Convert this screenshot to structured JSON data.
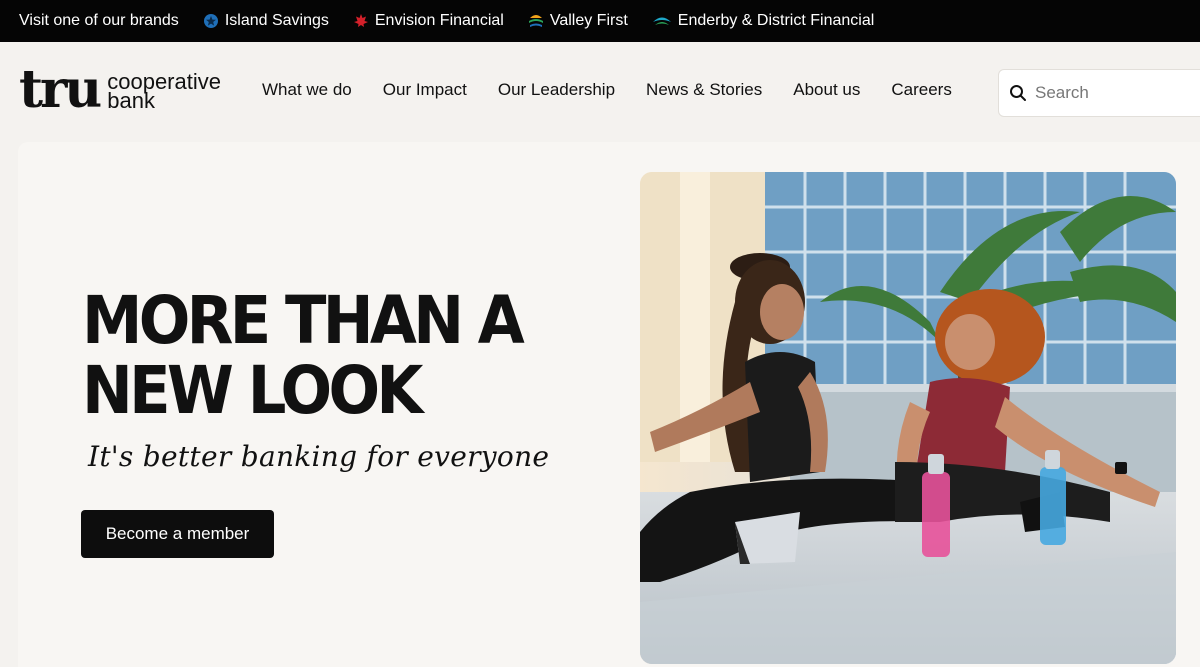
{
  "brandbar": {
    "visit_label": "Visit one of our brands",
    "brands": [
      {
        "label": "Island Savings",
        "icon": "island-savings-logo-icon",
        "color": "#1f6fb8"
      },
      {
        "label": "Envision Financial",
        "icon": "envision-leaf-icon",
        "color": "#d4202a"
      },
      {
        "label": "Valley First",
        "icon": "valley-first-logo-icon",
        "color": "#2aa35a"
      },
      {
        "label": "Enderby & District Financial",
        "icon": "enderby-logo-icon",
        "color": "#1ea8c9"
      }
    ]
  },
  "header": {
    "logo_primary": "tru",
    "logo_line1": "cooperative",
    "logo_line2": "bank",
    "nav": [
      "What we do",
      "Our Impact",
      "Our Leadership",
      "News & Stories",
      "About us",
      "Careers"
    ],
    "search_placeholder": "Search"
  },
  "hero": {
    "headline": "MORE THAN A NEW LOOK",
    "tagline": "It's better banking for everyone",
    "cta_label": "Become a member"
  },
  "colors": {
    "topbar": "#050505",
    "background": "#f4f2ef",
    "button": "#0d0d0d"
  }
}
